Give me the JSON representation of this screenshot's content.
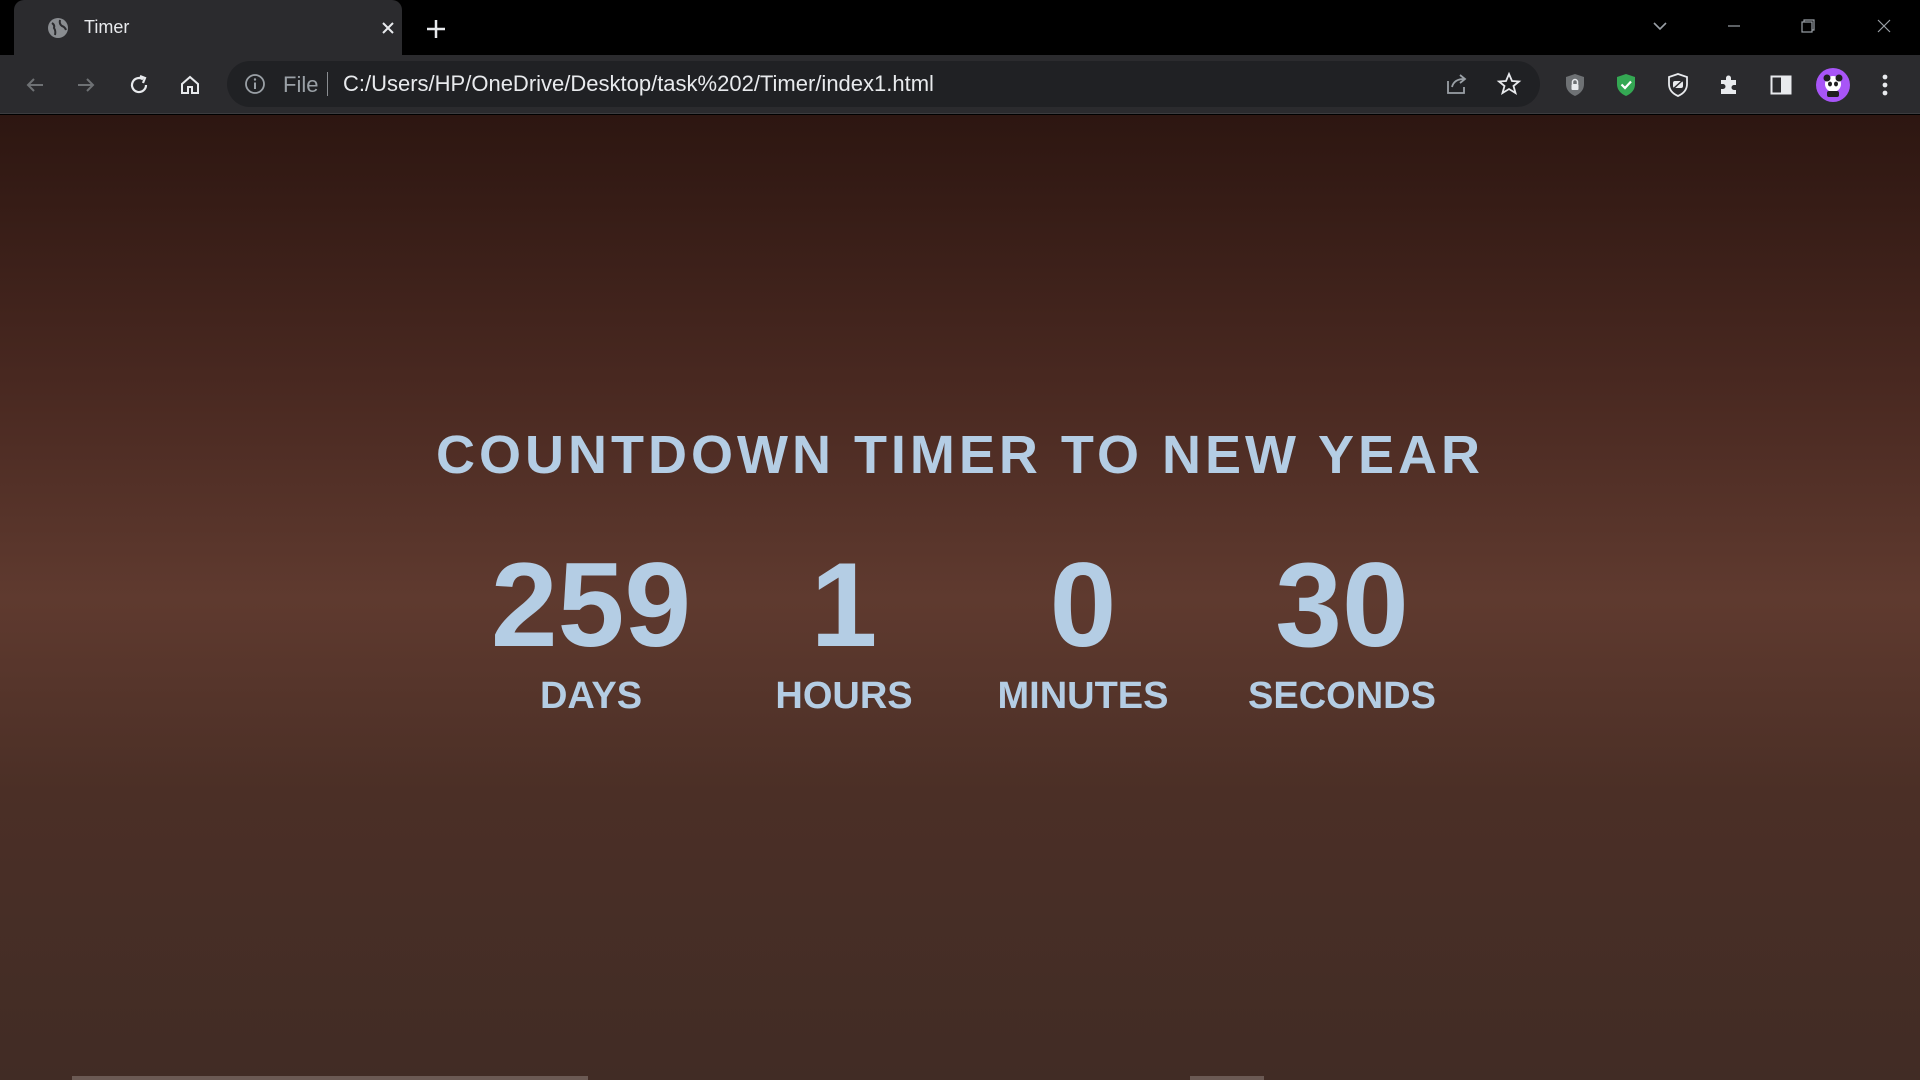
{
  "browser": {
    "tab": {
      "title": "Timer",
      "favicon": "globe-icon",
      "close_icon": "close-icon"
    },
    "new_tab_icon": "plus-icon",
    "window_controls": [
      "chevron-down-icon",
      "minimize-icon",
      "restore-icon",
      "close-icon"
    ],
    "toolbar": {
      "back_icon": "back-arrow-icon",
      "forward_icon": "forward-arrow-icon",
      "reload_icon": "reload-icon",
      "home_icon": "home-icon",
      "omnibox": {
        "info_icon": "info-icon",
        "scheme_label": "File",
        "url": "C:/Users/HP/OneDrive/Desktop/task%202/Timer/index1.html",
        "share_icon": "share-icon",
        "bookmark_icon": "star-icon"
      },
      "extensions": [
        "shield-lock-icon",
        "shield-check-icon",
        "shield-badge-icon",
        "puzzle-icon",
        "side-panel-icon"
      ],
      "profile_icon": "avatar",
      "menu_icon": "kebab-menu-icon"
    }
  },
  "page": {
    "heading": "COUNTDOWN TIMER TO NEW YEAR",
    "countdown": [
      {
        "value": "259",
        "label": "DAYS"
      },
      {
        "value": "1",
        "label": "HOURS"
      },
      {
        "value": "0",
        "label": "MINUTES"
      },
      {
        "value": "30",
        "label": "SECONDS"
      }
    ]
  },
  "colors": {
    "text_accent": "#b4cde4",
    "background_dark": "#2d1611",
    "background_mid": "#5f3a2f",
    "chrome_bg": "#2b2b2e",
    "omnibox_bg": "#202124",
    "extension_green": "#34a853",
    "avatar_purple": "#a855f7"
  }
}
